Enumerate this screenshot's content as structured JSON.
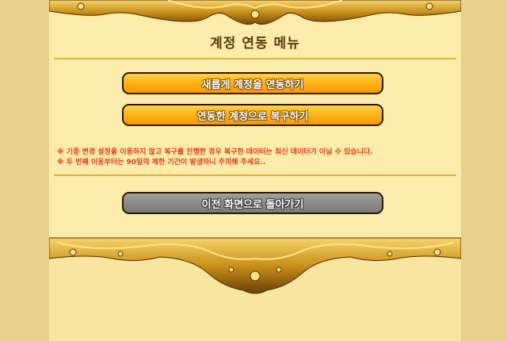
{
  "menu": {
    "title": "계정 연동 메뉴"
  },
  "buttons": {
    "link_new": "새롭게 계정을 연동하기",
    "restore": "연동한 계정으로 복구하기",
    "back": "이전 화면으로 돌아가기"
  },
  "notice": {
    "line1": "※ 기종 변경 설정을 이용하지 않고 복구를 진행한 경우 복구한 데이터는 최신 데이터가 아닐 수 있습니다.",
    "line2": "※ 두 번째 이용부터는 90일의 제한 기간이 발생하니 주의해 주세요.."
  },
  "colors": {
    "panel": "#fcecac",
    "orange_button": "#ffb419",
    "gray_button": "#8b8b8b",
    "notice_text": "#e03c16",
    "gold": "#c8901a"
  }
}
